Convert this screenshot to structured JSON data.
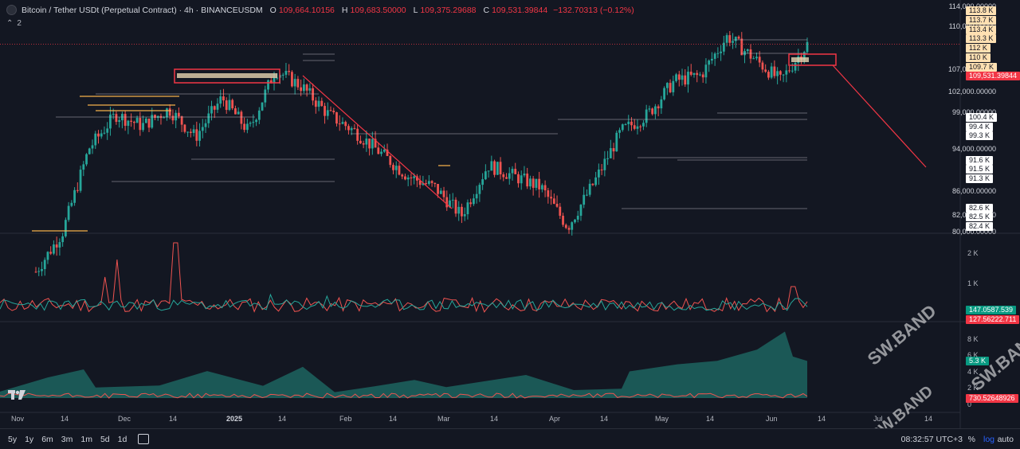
{
  "legend": {
    "title": "Bitcoin / Tether USDt (Perpetual Contract) · 4h · BINANCEUSDM",
    "o_label": "O",
    "o": "109,664.10156",
    "h_label": "H",
    "h": "109,683.50000",
    "l_label": "L",
    "l": "109,375.29688",
    "c_label": "C",
    "c": "109,531.39844",
    "chg": "−132.70313 (−0.12%)",
    "collapse_count": "2"
  },
  "price_scale": [
    "114,000.00000",
    "110,000.00000",
    "107,000.00000",
    "102,000.00000",
    "99,000.00000",
    "94,000.00000",
    "86,000.00000",
    "82,000.00000",
    "80,000.00000"
  ],
  "volume_scale": [
    "2 K",
    "1 K"
  ],
  "delta_scale": [
    "8 K",
    "6 K",
    "4 K",
    "2 K",
    "0"
  ],
  "level_tags_orange": [
    "113.8 K",
    "113.7 K",
    "113.4 K",
    "113.3 K",
    "112 K",
    "110 K",
    "109.7 K"
  ],
  "current_price_tag": "109,531.39844",
  "level_tags_white": [
    "100.4 K",
    "99.4 K",
    "99.3 K",
    "91.6 K",
    "91.5 K",
    "91.3 K",
    "82.6 K",
    "82.5 K",
    "82.4 K"
  ],
  "volume_tags": [
    "147.0587.539",
    "127.56222.711"
  ],
  "delta_tags": [
    "5.3 K",
    "730.52648926"
  ],
  "time_axis": [
    "Nov",
    "14",
    "Dec",
    "14",
    "2025",
    "14",
    "Feb",
    "14",
    "Mar",
    "14",
    "Apr",
    "14",
    "May",
    "14",
    "Jun",
    "14",
    "Jul",
    "14"
  ],
  "bottom_bar": {
    "ranges": [
      "5y",
      "1y",
      "6m",
      "3m",
      "1m",
      "5d",
      "1d"
    ],
    "time": "08:32:57 UTC+3",
    "pct": "%",
    "log": "log",
    "auto": "auto"
  },
  "watermark": "SW.BAND",
  "colors": {
    "bg": "#131722",
    "up": "#26a69a",
    "down": "#ef5350",
    "accent_red": "#f23645",
    "level_orange": "#ffe0b2",
    "teal_area": "#1f6f68"
  },
  "chart_data": {
    "type": "candlestick",
    "symbol": "BTCUSDT.P",
    "exchange": "BINANCEUSDM",
    "timeframe": "4h",
    "x": [
      "Nov",
      "Dec",
      "2025",
      "Feb",
      "Mar",
      "Apr",
      "May",
      "Jun",
      "Jul"
    ],
    "y_approx_close_path": [
      69000,
      76000,
      91000,
      97000,
      95000,
      98000,
      93000,
      100000,
      94000,
      105000,
      102000,
      97000,
      94000,
      90000,
      86000,
      84000,
      79000,
      88000,
      86000,
      84000,
      77000,
      85000,
      94000,
      97000,
      103000,
      104000,
      111000,
      107000,
      103000,
      109531
    ],
    "ylim": [
      76000,
      116000
    ],
    "last_close": 109531.39844
  }
}
